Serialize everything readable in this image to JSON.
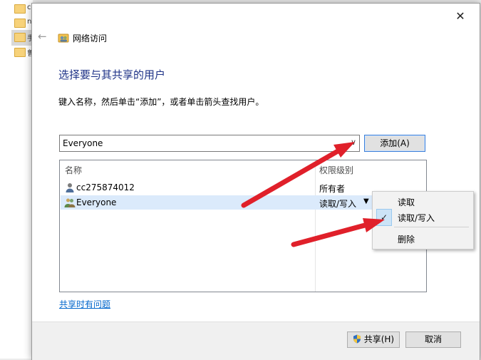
{
  "background": {
    "chars": [
      "c",
      "n",
      "手",
      "鲁"
    ]
  },
  "window": {
    "title": "网络访问",
    "close_glyph": "✕",
    "back_glyph": "←"
  },
  "main": {
    "heading": "选择要与其共享的用户",
    "instruction": "键入名称，然后单击“添加”，或者单击箭头查找用户。",
    "combo_value": "Everyone",
    "combo_arrow": "∨",
    "add_label": "添加(A)"
  },
  "list": {
    "headers": {
      "name": "名称",
      "permission": "权限级别"
    },
    "rows": [
      {
        "name": "cc275874012",
        "permission": "所有者",
        "icon": "user-icon"
      },
      {
        "name": "Everyone",
        "permission": "读取/写入",
        "icon": "group-icon",
        "selected": true
      }
    ],
    "dropdown_arrow": "▼"
  },
  "menu": {
    "items": [
      {
        "label": "读取"
      },
      {
        "label": "读取/写入",
        "checked": true
      },
      {
        "label": "删除"
      }
    ],
    "check_glyph": "✓"
  },
  "help_link": "共享时有问题",
  "footer": {
    "share_label": "共享(H)",
    "cancel_label": "取消"
  },
  "colors": {
    "heading": "#1e3287",
    "selection": "#dbeafb",
    "arrow": "#e0202a",
    "link": "#0066cc"
  }
}
